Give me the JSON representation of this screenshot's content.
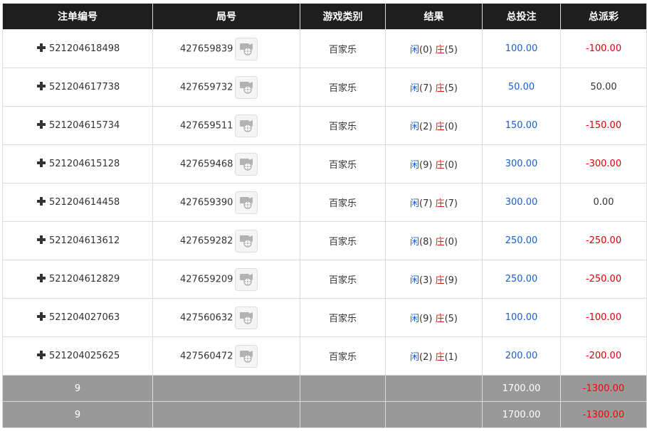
{
  "table": {
    "headers": [
      "注单编号",
      "局号",
      "游戏类别",
      "结果",
      "总投注",
      "总派彩"
    ],
    "rows": [
      {
        "order_id": "521204618498",
        "round_id": "427659839",
        "game": "百家乐",
        "player_label": "闲",
        "player_score": "(0)",
        "banker_label": "庄",
        "banker_score": "(5)",
        "bet": "100.00",
        "payout": "-100.00",
        "payout_color": "red"
      },
      {
        "order_id": "521204617738",
        "round_id": "427659732",
        "game": "百家乐",
        "player_label": "闲",
        "player_score": "(7)",
        "banker_label": "庄",
        "banker_score": "(5)",
        "bet": "50.00",
        "payout": "50.00",
        "payout_color": "dark"
      },
      {
        "order_id": "521204615734",
        "round_id": "427659511",
        "game": "百家乐",
        "player_label": "闲",
        "player_score": "(2)",
        "banker_label": "庄",
        "banker_score": "(0)",
        "bet": "150.00",
        "payout": "-150.00",
        "payout_color": "red"
      },
      {
        "order_id": "521204615128",
        "round_id": "427659468",
        "game": "百家乐",
        "player_label": "闲",
        "player_score": "(9)",
        "banker_label": "庄",
        "banker_score": "(0)",
        "bet": "300.00",
        "payout": "-300.00",
        "payout_color": "red"
      },
      {
        "order_id": "521204614458",
        "round_id": "427659390",
        "game": "百家乐",
        "player_label": "闲",
        "player_score": "(7)",
        "banker_label": "庄",
        "banker_score": "(7)",
        "bet": "300.00",
        "payout": "0.00",
        "payout_color": "dark"
      },
      {
        "order_id": "521204613612",
        "round_id": "427659282",
        "game": "百家乐",
        "player_label": "闲",
        "player_score": "(8)",
        "banker_label": "庄",
        "banker_score": "(0)",
        "bet": "250.00",
        "payout": "-250.00",
        "payout_color": "red"
      },
      {
        "order_id": "521204612829",
        "round_id": "427659209",
        "game": "百家乐",
        "player_label": "闲",
        "player_score": "(3)",
        "banker_label": "庄",
        "banker_score": "(9)",
        "bet": "250.00",
        "payout": "-250.00",
        "payout_color": "red"
      },
      {
        "order_id": "521204027063",
        "round_id": "427560632",
        "game": "百家乐",
        "player_label": "闲",
        "player_score": "(9)",
        "banker_label": "庄",
        "banker_score": "(5)",
        "bet": "100.00",
        "payout": "-100.00",
        "payout_color": "red"
      },
      {
        "order_id": "521204025625",
        "round_id": "427560472",
        "game": "百家乐",
        "player_label": "闲",
        "player_score": "(2)",
        "banker_label": "庄",
        "banker_score": "(1)",
        "bet": "200.00",
        "payout": "-200.00",
        "payout_color": "red"
      }
    ],
    "totals": [
      {
        "count": "9",
        "bet": "1700.00",
        "payout": "-1300.00"
      },
      {
        "count": "9",
        "bet": "1700.00",
        "payout": "-1300.00"
      }
    ]
  },
  "icons": {
    "expand": "plus-icon",
    "replay": "video-replay-icon"
  },
  "colors": {
    "header_bg": "#1e1e1e",
    "footer_bg": "#999999",
    "player": "#1a5fd1",
    "banker": "#d11a1a",
    "loss": "#e00000"
  }
}
